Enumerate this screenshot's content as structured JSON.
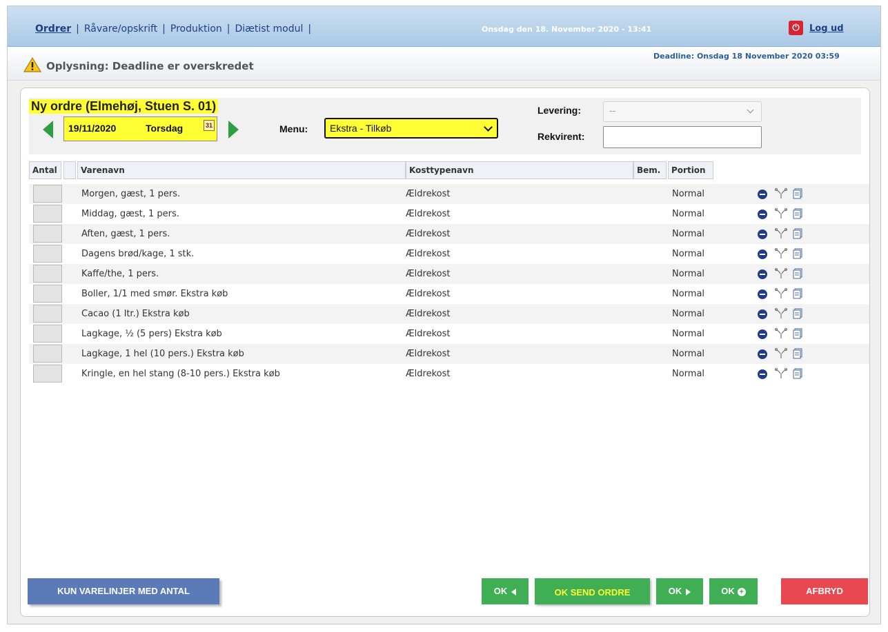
{
  "nav": {
    "items": [
      {
        "label": "Ordrer",
        "active": true
      },
      {
        "label": "Råvare/opskrift",
        "active": false
      },
      {
        "label": "Produktion",
        "active": false
      },
      {
        "label": "Diætist modul",
        "active": false
      }
    ],
    "separator": "|"
  },
  "topbar": {
    "datetime": "Onsdag den 18. November 2020 -  13:41",
    "logout_label": "Log ud"
  },
  "info": {
    "message": "Oplysning: Deadline er overskredet",
    "deadline": "Deadline: Onsdag 18 November 2020 03:59"
  },
  "order": {
    "title": "Ny ordre (Elmehøj, Stuen S. 01)",
    "date": "19/11/2020",
    "weekday": "Torsdag",
    "calendar_icon_text": "31",
    "menu_label": "Menu:",
    "menu_value": "Ekstra - Tilkøb",
    "levering_label": "Levering:",
    "levering_value": "--",
    "rekvirent_label": "Rekvirent:",
    "rekvirent_value": ""
  },
  "table": {
    "headers": {
      "antal": "Antal",
      "blank": "",
      "varenavn": "Varenavn",
      "kosttypenavn": "Kosttypenavn",
      "bem": "Bem.",
      "portion": "Portion"
    },
    "rows": [
      {
        "varenavn": "Morgen, gæst, 1 pers.",
        "kost": "Ældrekost",
        "portion": "Normal"
      },
      {
        "varenavn": "Middag, gæst, 1 pers.",
        "kost": "Ældrekost",
        "portion": "Normal"
      },
      {
        "varenavn": "Aften, gæst, 1 pers.",
        "kost": "Ældrekost",
        "portion": "Normal"
      },
      {
        "varenavn": "Dagens brød/kage, 1 stk.",
        "kost": "Ældrekost",
        "portion": "Normal"
      },
      {
        "varenavn": "Kaffe/the, 1 pers.",
        "kost": "Ældrekost",
        "portion": "Normal"
      },
      {
        "varenavn": "Boller, 1/1 med smør. Ekstra køb",
        "kost": "Ældrekost",
        "portion": "Normal"
      },
      {
        "varenavn": "Cacao (1 ltr.) Ekstra køb",
        "kost": "Ældrekost",
        "portion": "Normal"
      },
      {
        "varenavn": "Lagkage, ½ (5 pers) Ekstra køb",
        "kost": "Ældrekost",
        "portion": "Normal"
      },
      {
        "varenavn": "Lagkage, 1 hel (10 pers.) Ekstra køb",
        "kost": "Ældrekost",
        "portion": "Normal"
      },
      {
        "varenavn": "Kringle, en hel stang (8-10 pers.) Ekstra køb",
        "kost": "Ældrekost",
        "portion": "Normal"
      }
    ],
    "row_icons": [
      "minus-circle-icon",
      "scissors-icon",
      "document-icon"
    ]
  },
  "buttons": {
    "kun_varelinjer": "KUN VARELINJER MED ANTAL",
    "ok_prev": "OK",
    "ok_send": "OK SEND ORDRE",
    "ok_next": "OK",
    "ok_add": "OK",
    "afbryd": "AFBRYD"
  },
  "colors": {
    "highlight": "#ffff33",
    "nav_blue": "#1f3f85",
    "ok_green": "#3fae55",
    "afbryd_red": "#e8484f",
    "kun_blue": "#5b7bb8"
  }
}
